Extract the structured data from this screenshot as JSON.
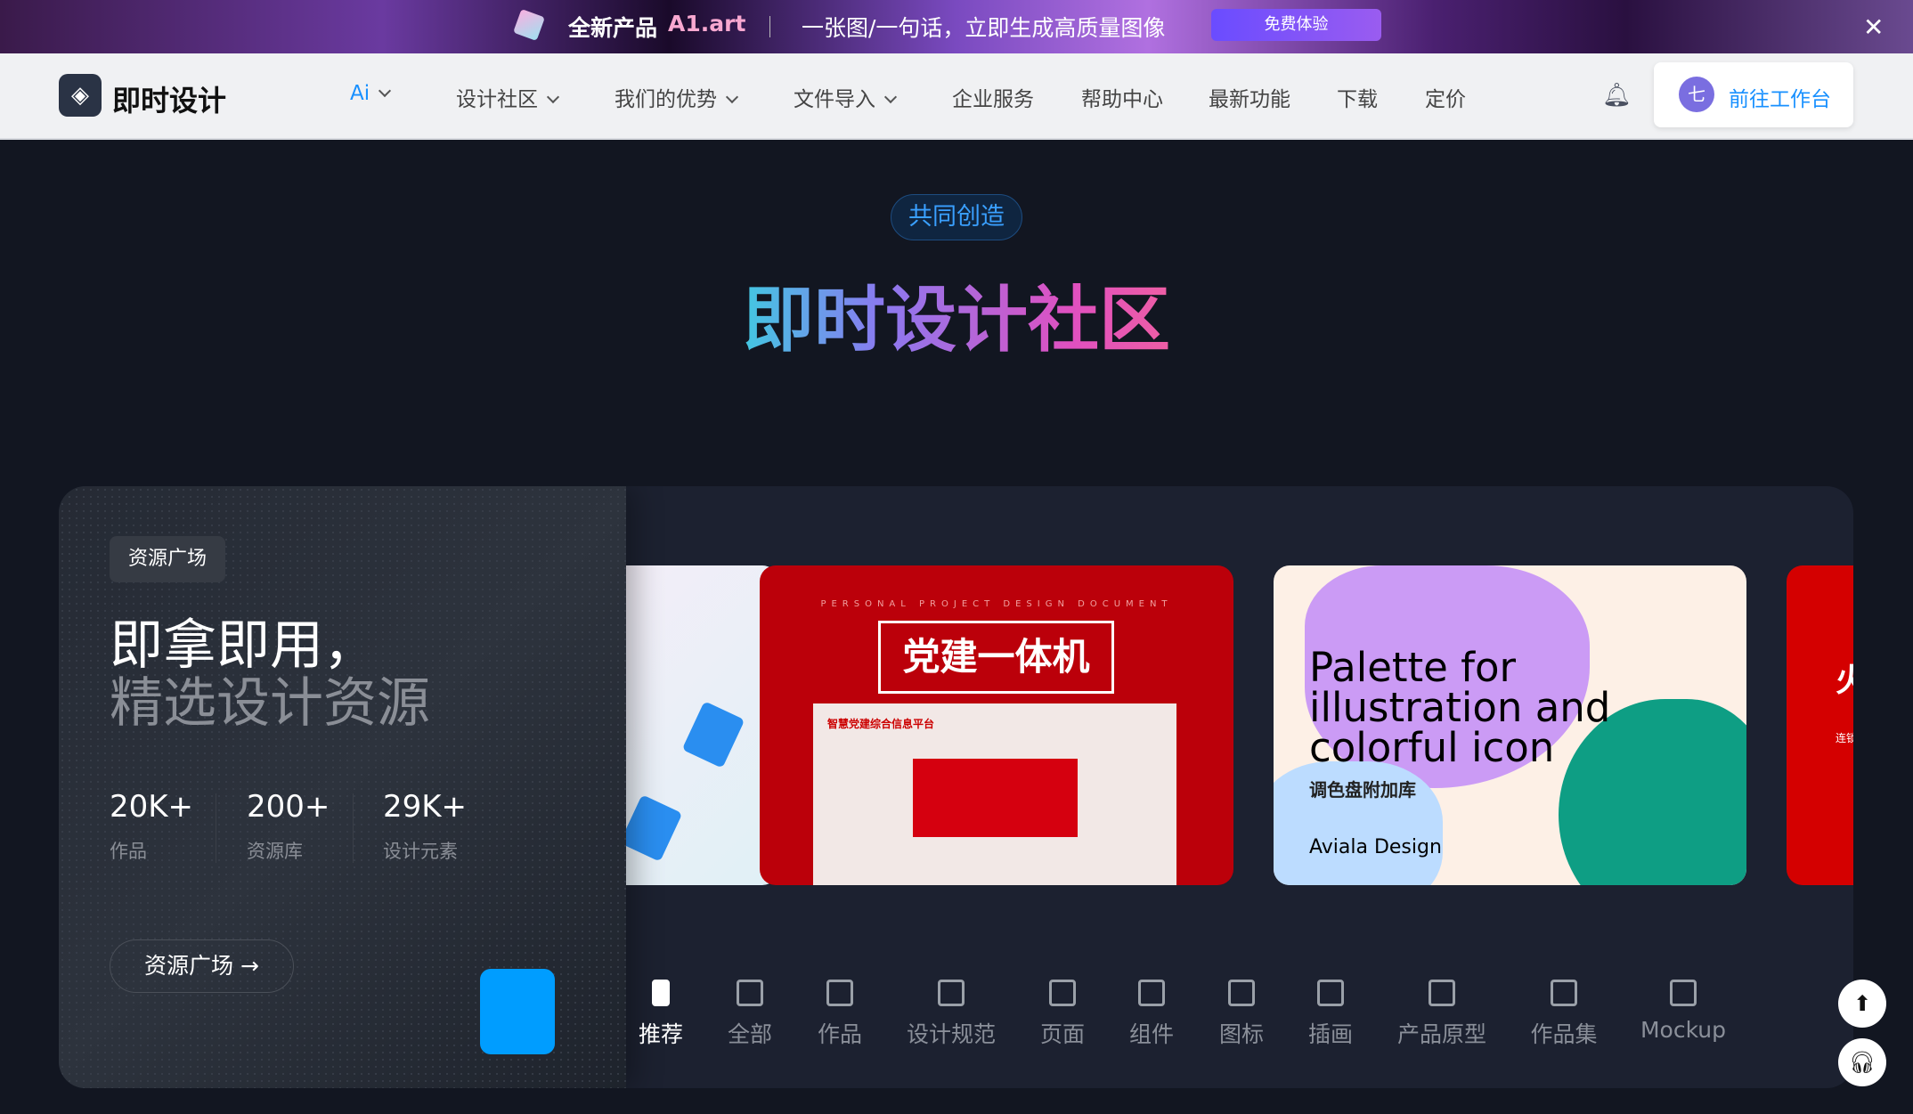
{
  "banner": {
    "product_prefix": "全新产品",
    "product_name": "A1.art",
    "slogan": "一张图/一句话，立即生成高质量图像",
    "cta": "免费体验",
    "close_icon": "close-icon"
  },
  "nav": {
    "brand": "即时设计",
    "items": [
      {
        "label": "Ai",
        "dropdown": true,
        "active": true
      },
      {
        "label": "设计社区",
        "dropdown": true
      },
      {
        "label": "我们的优势",
        "dropdown": true
      },
      {
        "label": "文件导入",
        "dropdown": true
      },
      {
        "label": "企业服务"
      },
      {
        "label": "帮助中心"
      },
      {
        "label": "最新功能"
      },
      {
        "label": "下载"
      },
      {
        "label": "定价"
      }
    ],
    "avatar_initial": "七",
    "workspace_button": "前往工作台"
  },
  "hero": {
    "pill": "共同创造",
    "title": "即时设计社区"
  },
  "resource": {
    "tag": "资源广场",
    "headline1": "即拿即用，",
    "headline2": "精选设计资源",
    "stats": [
      {
        "value": "20K+",
        "label": "作品"
      },
      {
        "value": "200+",
        "label": "资源库"
      },
      {
        "value": "29K+",
        "label": "设计元素"
      }
    ],
    "button": "资源广场 →"
  },
  "cards": [
    {
      "subtitle": "PERSONAL PROJECT DESIGN DOCUMENT",
      "title": "党建一体机",
      "inner_title": "智慧党建综合信息平台"
    },
    {
      "title": "Palette for illustration and colorful icon",
      "subtitle": "调色盘附加库",
      "author": "Aviala Design"
    },
    {
      "title": "火",
      "text": "连锁"
    }
  ],
  "tabs": [
    {
      "label": "推荐",
      "icon": "bookmark-icon",
      "active": true
    },
    {
      "label": "全部",
      "icon": "grid-icon"
    },
    {
      "label": "作品",
      "icon": "device-icon"
    },
    {
      "label": "设计规范",
      "icon": "cube-icon"
    },
    {
      "label": "页面",
      "icon": "page-icon"
    },
    {
      "label": "组件",
      "icon": "toggle-icon"
    },
    {
      "label": "图标",
      "icon": "star-icon"
    },
    {
      "label": "插画",
      "icon": "feather-icon"
    },
    {
      "label": "产品原型",
      "icon": "layout-icon"
    },
    {
      "label": "作品集",
      "icon": "briefcase-icon"
    },
    {
      "label": "Mockup",
      "icon": "monitor-icon"
    }
  ],
  "colors": {
    "accent": "#1890ff",
    "panel": "#1c2130",
    "background": "#121621",
    "promo": "#7a55f5"
  }
}
